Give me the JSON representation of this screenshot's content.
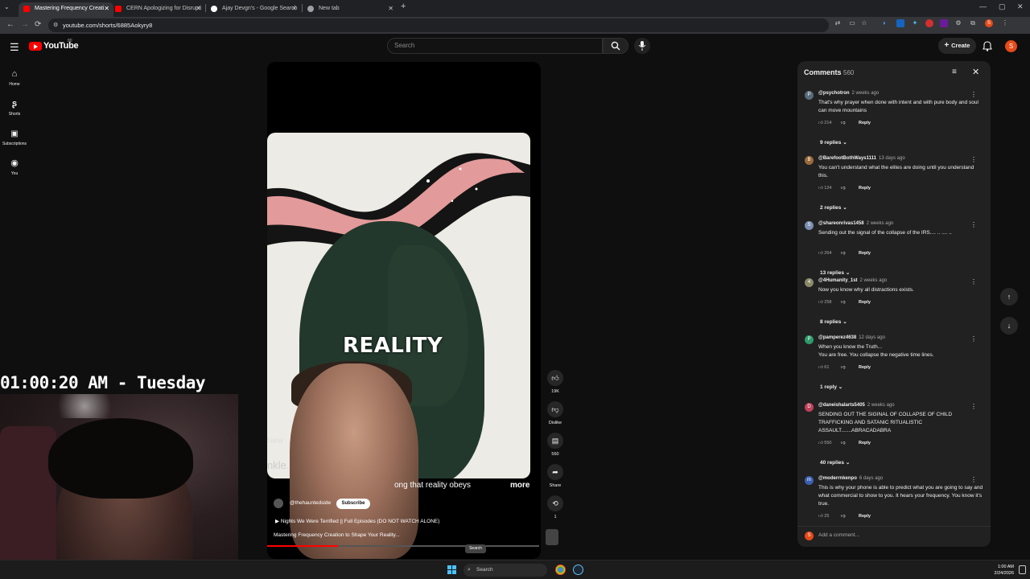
{
  "browser": {
    "tabs": [
      {
        "label": "Mastering Frequency Creati",
        "active": true
      },
      {
        "label": "CERN Apologizing for Disrupti",
        "active": false
      },
      {
        "label": "Ajay Devgn's - Google Search",
        "active": false
      },
      {
        "label": "New tab",
        "active": false
      }
    ],
    "url": "youtube.com/shorts/6885Aokyry8"
  },
  "header": {
    "logo_text": "YouTube",
    "logo_sup": "80",
    "search_placeholder": "Search",
    "create_label": "Create",
    "avatar_letter": "S"
  },
  "guide": [
    {
      "label": "Home",
      "icon": "home-icon"
    },
    {
      "label": "Shorts",
      "icon": "shorts-icon"
    },
    {
      "label": "Subscriptions",
      "icon": "subscriptions-icon"
    },
    {
      "label": "You",
      "icon": "you-icon"
    }
  ],
  "overlay": {
    "clock": "01:00:20 AM - Tuesday"
  },
  "player": {
    "big_text": "REALITY",
    "caption_left1": "New",
    "caption_left2": "nkle.",
    "caption_right": "ong that reality obeys",
    "more": "more",
    "channel": "@thehauntedside",
    "subscribe": "Subscribe",
    "playlist": "Nights We Were Terrified || Full Episodes (DO NOT WATCH ALONE)",
    "title": "Mastering Frequency Creation to Shape Your Reality...",
    "progress": 0.26
  },
  "actions": {
    "likes": "19K",
    "dislike": "Dislike",
    "comments": "560",
    "share": "Share",
    "remix": "1"
  },
  "comments_panel": {
    "title": "Comments",
    "count": "560",
    "add_placeholder": "Add a comment...",
    "comments": [
      {
        "avatar": "P",
        "color": "#5a6b7a",
        "user": "@psychotron",
        "time": "2 weeks ago",
        "text": "That's why prayer when done with intent and with pure body and soul can move mountains",
        "likes": "214",
        "replies": "9 replies"
      },
      {
        "avatar": "B",
        "color": "#9a6a3a",
        "user": "@BarefootBothWays1111",
        "time": "13 days ago",
        "text": "You can't understand what the elites are doing until you understand this.",
        "likes": "124",
        "replies": "2 replies"
      },
      {
        "avatar": "S",
        "color": "#7a8fb0",
        "user": "@shareonrivas1458",
        "time": "2 weeks ago",
        "text": "Sending out the signal of the collapse of the IRS.... .. .... ..",
        "likes": "264",
        "replies": "13 replies"
      },
      {
        "avatar": "4",
        "color": "#8a8a6a",
        "user": "@4Humanity_1st",
        "time": "2 weeks ago",
        "text": "Now you know why all distractions exists.",
        "likes": "258",
        "replies": "8 replies"
      },
      {
        "avatar": "P",
        "color": "#2e9b6a",
        "user": "@pamperez4638",
        "time": "12 days ago",
        "text": "When you know the Truth...\nYou are free. You collapse the negative time lines.",
        "likes": "61",
        "replies": "1 reply"
      },
      {
        "avatar": "D",
        "color": "#c0405a",
        "user": "@daneishalarts5405",
        "time": "2 weeks ago",
        "text": "SENDING OUT THE SIGINAL OF COLLAPSE OF CHILD TRAFFICKING AND SATANIC RITUALISTIC ASSAULT.......ABRACADABRA",
        "likes": "550",
        "replies": "40 replies"
      },
      {
        "avatar": "m",
        "color": "#3a5fb0",
        "user": "@moderrnkenpo",
        "time": "6 days ago",
        "text": "This is why your phone is able to predict what you are going to say and what commercial to show to you. It hears your frequency. You know it's true.",
        "likes": "25",
        "replies": ""
      }
    ],
    "reply_label": "Reply"
  },
  "tooltip": "Search",
  "taskbar": {
    "search": "Search",
    "time": "1:00 AM",
    "date": "2/24/2026"
  }
}
